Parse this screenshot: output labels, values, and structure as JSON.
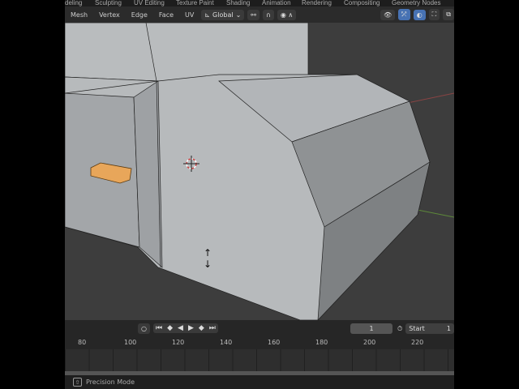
{
  "workspaces": [
    "deling",
    "Sculpting",
    "UV Editing",
    "Texture Paint",
    "Shading",
    "Animation",
    "Rendering",
    "Compositing",
    "Geometry Nodes"
  ],
  "header": {
    "menus": [
      "Mesh",
      "Vertex",
      "Edge",
      "Face",
      "UV"
    ],
    "transform_orientation": "Global"
  },
  "timeline": {
    "current_frame": "1",
    "start_label": "Start",
    "start_value": "1",
    "ruler": [
      "80",
      "100",
      "120",
      "140",
      "160",
      "180",
      "200",
      "220"
    ]
  },
  "status": {
    "hint": "Precision Mode",
    "key": "shift-icon"
  },
  "colors": {
    "accent": "#4772b3",
    "selected": "#e8a65a"
  }
}
